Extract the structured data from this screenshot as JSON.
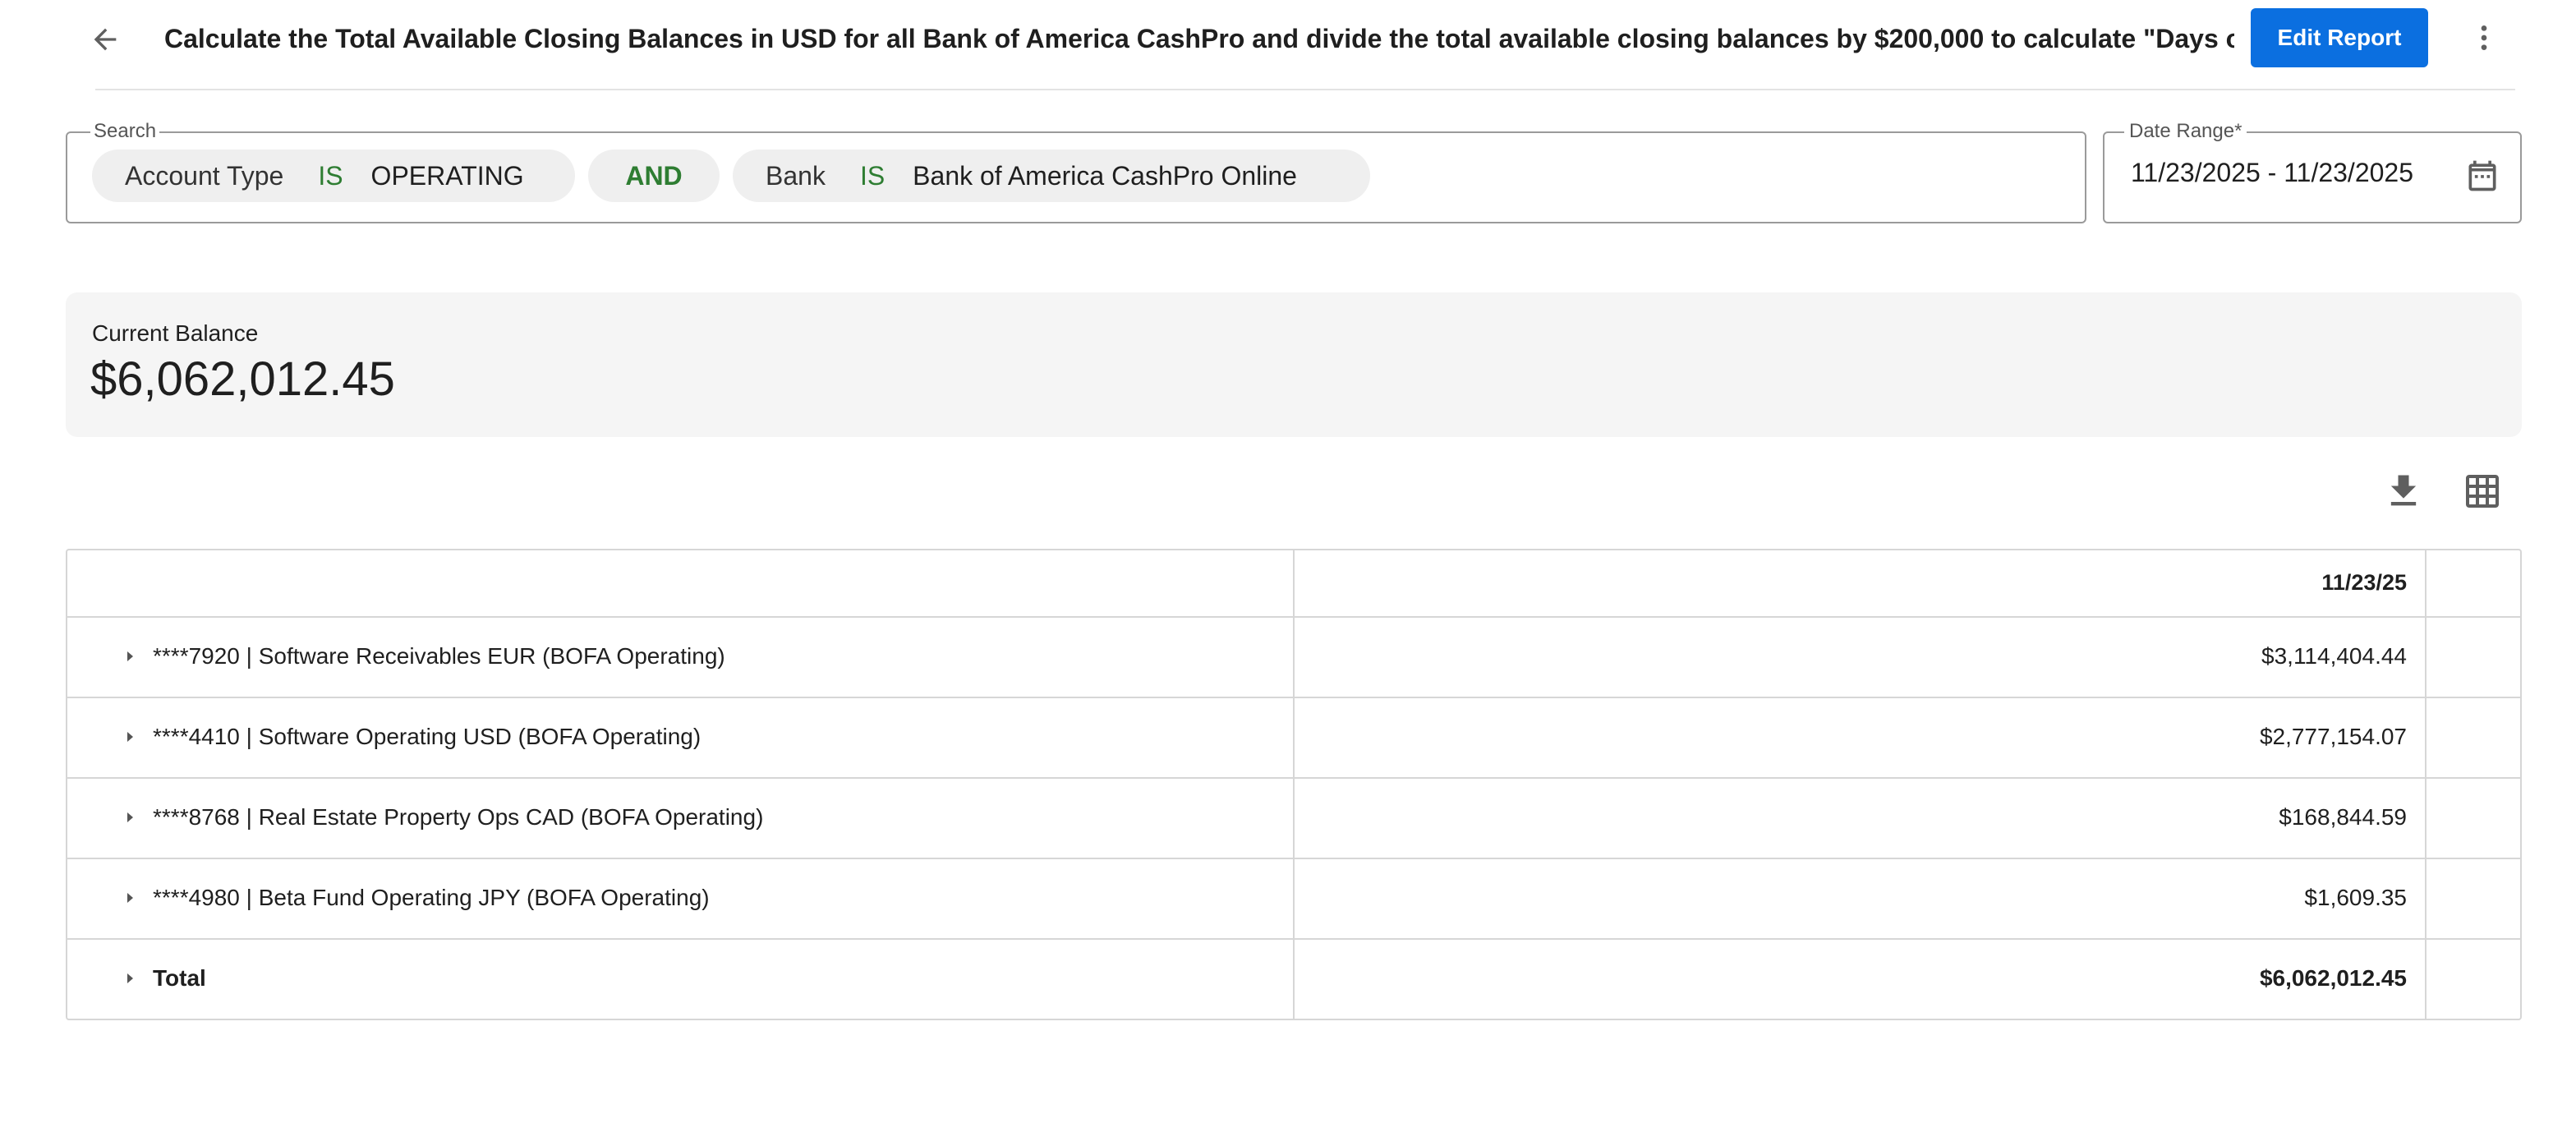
{
  "header": {
    "title": "Calculate the Total Available Closing Balances in USD for all Bank of America CashPro and divide the total available closing balances by $200,000 to calculate \"Days of Ca",
    "edit_label": "Edit Report"
  },
  "search": {
    "legend": "Search",
    "filters": [
      {
        "field": "Account Type",
        "op": "IS",
        "value": "OPERATING"
      },
      {
        "field": "Bank",
        "op": "IS",
        "value": "Bank of America CashPro Online"
      }
    ],
    "joiner": "AND"
  },
  "date_range": {
    "legend": "Date Range*",
    "value": "11/23/2025 - 11/23/2025"
  },
  "balance": {
    "label": "Current Balance",
    "value": "$6,062,012.45"
  },
  "table": {
    "column_header": "11/23/25",
    "rows": [
      {
        "label": "****7920 | Software Receivables EUR (BOFA Operating)",
        "value": "$3,114,404.44"
      },
      {
        "label": "****4410 | Software Operating USD (BOFA Operating)",
        "value": "$2,777,154.07"
      },
      {
        "label": "****8768 | Real Estate Property Ops CAD (BOFA Operating)",
        "value": "$168,844.59"
      },
      {
        "label": "****4980 | Beta Fund Operating JPY (BOFA Operating)",
        "value": "$1,609.35"
      }
    ],
    "total": {
      "label": "Total",
      "value": "$6,062,012.45"
    }
  },
  "colors": {
    "accent": "#0b6fe0",
    "operator": "#2e7d32",
    "chip_bg": "#efefef",
    "card_bg": "#f5f5f5"
  },
  "icons": {
    "back": "arrow-left-icon",
    "more": "more-vertical-icon",
    "calendar": "calendar-icon",
    "download": "download-icon",
    "grid": "table-grid-icon",
    "expand": "caret-right-icon"
  }
}
